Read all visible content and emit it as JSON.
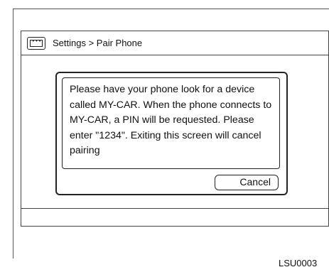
{
  "titlebar": {
    "icon": "keypad-icon",
    "title": "Settings > Pair Phone"
  },
  "dialog": {
    "message": "Please have your phone look for a device called MY-CAR. When the phone connects to MY-CAR, a PIN will be requested. Please enter \"1234\". Exiting this screen will cancel pairing",
    "cancel_label": "Cancel"
  },
  "figure": {
    "ref_code": "LSU0003"
  }
}
